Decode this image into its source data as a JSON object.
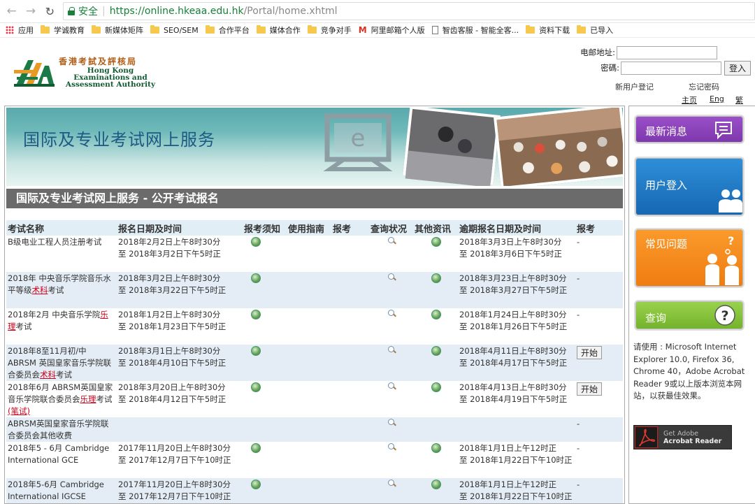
{
  "browser": {
    "secure_label": "安全",
    "url_scheme_host": "https://online.hkeaa.edu.hk",
    "url_path": "/Portal/home.xhtml",
    "bookmarks": [
      "应用",
      "学诚教育",
      "新媒体矩阵",
      "SEO/SEM",
      "合作平台",
      "媒体合作",
      "竞争对手",
      "阿里邮箱个人版",
      "智齿客服 - 智能全客...",
      "资料下载",
      "已导入"
    ]
  },
  "logo": {
    "zh": "香港考試及評核局",
    "en_line1": "Hong Kong",
    "en_line2": "Examinations and",
    "en_line3": "Assessment Authority"
  },
  "login": {
    "email_label": "电邮地址:",
    "password_label": "密碼:",
    "submit_label": "登入",
    "register_link": "新用户登记",
    "forgot_link": "忘记密码",
    "lang_home": "主页",
    "lang_eng": "Eng",
    "lang_trad": "繁"
  },
  "banner": {
    "title": "国际及专业考试网上服务",
    "e_letter": "e"
  },
  "section_title": "国际及专业考试网上服务 - 公开考试报名",
  "table": {
    "headers": [
      "考试名称",
      "报名日期及时间",
      "报考须知",
      "使用指南",
      "报考",
      "查询状况",
      "其他资讯",
      "逾期报名日期及时间",
      "报考"
    ],
    "start_label": "开始",
    "rows": [
      {
        "name": "B级电业工程人员注册考试",
        "name_red": "",
        "name_after": "",
        "date1": "2018年2月2日上午8时30分",
        "date2": "至 2018年3月2日下午5时正",
        "late1": "2018年3月3日上午8时30分",
        "late2": "至 2018年3月6日下午5时正",
        "action": "-"
      },
      {
        "name": "2018年 中央音乐学院音乐水平等级",
        "name_red": "术科",
        "name_after": "考试",
        "date1": "2018年3月2日上午8时30分",
        "date2": "至 2018年3月22日下午5时正",
        "late1": "2018年3月23日上午8时30分",
        "late2": "至 2018年3月27日下午5时正",
        "action": "-"
      },
      {
        "name": "2018年2月 中央音乐学院",
        "name_red": "乐理",
        "name_after": "考试",
        "date1": "2018年1月2日上午8时30分",
        "date2": "至 2018年1月23日下午5时正",
        "late1": "2018年1月24日上午8时30分",
        "late2": "至 2018年1月26日下午5时正",
        "action": "-"
      },
      {
        "name": "2018年8至11月初/中 ABRSM 英国皇家音乐学院联合委员会",
        "name_red": "术科",
        "name_after": "考试",
        "date1": "2018年3月1日上午8时30分",
        "date2": "至 2018年4月10日下午5时正",
        "late1": "2018年4月11日上午8时30分",
        "late2": "至 2018年4月17日下午5时正",
        "action": "开始"
      },
      {
        "name": "2018年6月 ABRSM英国皇家音乐学院联合委员会",
        "name_red": "乐理",
        "name_after": "考试",
        "name_red2": "(笔试)",
        "date1": "2018年3月20日上午8时30分",
        "date2": "至 2018年4月12日下午5时正",
        "late1": "2018年4月13日上午8时30分",
        "late2": "至 2018年4月19日下午5时正",
        "action": "开始"
      },
      {
        "name": "ABRSM英国皇家音乐学院联合委员会其他收费",
        "name_red": "",
        "name_after": "",
        "date1": "",
        "date2": "",
        "late1": "",
        "late2": "",
        "action": "-"
      },
      {
        "name": "2018年5 - 6月 Cambridge International GCE",
        "name_red": "",
        "name_after": "",
        "date1": "2017年11月20日上午8时30分",
        "date2": "至 2017年12月7日下午10时正",
        "late1": "2018年1月1日上午12时正",
        "late2": "至 2018年1月22日下午10时正",
        "action": "-"
      },
      {
        "name": "2018年5-6月 Cambridge International IGCSE",
        "name_red": "",
        "name_after": "",
        "date1": "2017年11月20日上午8时30分",
        "date2": "至 2017年12月7日下午10时正",
        "late1": "2018年1月1日上午12时正",
        "late2": "至 2018年1月22日下午10时正",
        "action": "-"
      }
    ]
  },
  "sidebar": {
    "news": "最新消息",
    "user_login": "用户登入",
    "faq": "常见问题",
    "query": "查询",
    "requirements": "请使用 : Microsoft Internet Explorer 10.0, Firefox 36, Chrome 40，Adobe Acrobat Reader 9或以上版本浏览本网站，以获最佳效果。",
    "adobe_line1": "Get Adobe",
    "adobe_line2": "Acrobat Reader"
  },
  "colors": {
    "news": "#8b44bb",
    "login": "#1f78c6",
    "faq": "#f28a1b",
    "query": "#86c33c",
    "header_bg": "#e2eef6",
    "alt_row": "#e4edf5"
  }
}
